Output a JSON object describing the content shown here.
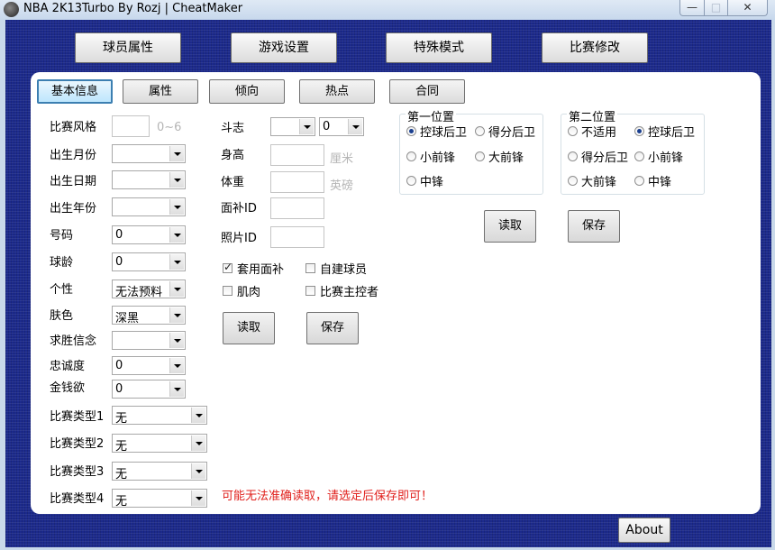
{
  "window": {
    "title": "NBA 2K13Turbo By Rozj | CheatMaker",
    "controls": {
      "minimize": "—",
      "maximize": "□",
      "close": "✕"
    }
  },
  "top_buttons": [
    "球员属性",
    "游戏设置",
    "特殊模式",
    "比赛修改"
  ],
  "tabs": [
    "基本信息",
    "属性",
    "倾向",
    "热点",
    "合同"
  ],
  "active_tab": "基本信息",
  "left_fields": {
    "style_label": "比赛风格",
    "style_hint": "0~6",
    "birth_month_label": "出生月份",
    "birth_day_label": "出生日期",
    "birth_year_label": "出生年份",
    "number_label": "号码",
    "number_value": "0",
    "age_label": "球龄",
    "age_value": "0",
    "personality_label": "个性",
    "personality_value": "无法预料",
    "skin_label": "肤色",
    "skin_value": "深黑",
    "win_label": "求胜信念",
    "loyalty_label": "忠诚度",
    "loyalty_value": "0",
    "money_label": "金钱欲",
    "money_value": "0",
    "type1_label": "比赛类型1",
    "type1_value": "无",
    "type2_label": "比赛类型2",
    "type2_value": "无",
    "type3_label": "比赛类型3",
    "type3_value": "无",
    "type4_label": "比赛类型4",
    "type4_value": "无"
  },
  "middle_fields": {
    "fight_label": "斗志",
    "fight_value": "0",
    "height_label": "身高",
    "height_unit": "厘米",
    "weight_label": "体重",
    "weight_unit": "英磅",
    "face_id_label": "面补ID",
    "photo_id_label": "照片ID",
    "use_face_label": "套用面补",
    "use_face_checked": true,
    "custom_player_label": "自建球员",
    "muscle_label": "肌肉",
    "main_controller_label": "比赛主控者",
    "read_label": "读取",
    "save_label": "保存"
  },
  "position1": {
    "title": "第一位置",
    "options": [
      "控球后卫",
      "得分后卫",
      "小前锋",
      "大前锋",
      "中锋"
    ],
    "selected": "控球后卫"
  },
  "position2": {
    "title": "第二位置",
    "options": [
      "不适用",
      "控球后卫",
      "得分后卫",
      "小前锋",
      "大前锋",
      "中锋"
    ],
    "selected": "控球后卫"
  },
  "position_buttons": {
    "read": "读取",
    "save": "保存"
  },
  "warning": "可能无法准确读取，请选定后保存即可！",
  "about_label": "About"
}
